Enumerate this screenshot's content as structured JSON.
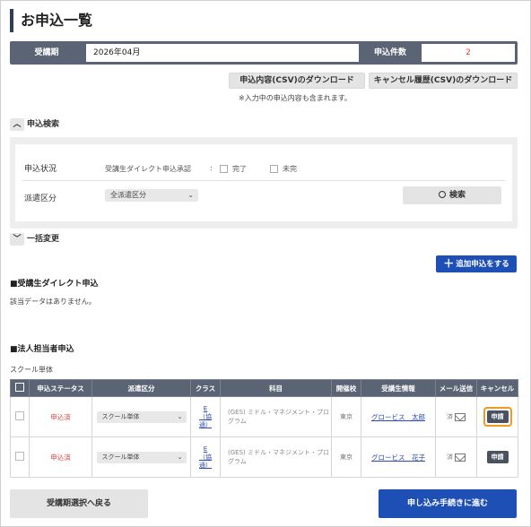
{
  "page": {
    "title": "お申込一覧"
  },
  "period": {
    "period_label": "受講期",
    "period_value": "2026年04月",
    "count_label": "申込件数",
    "count_value": "2"
  },
  "downloads": {
    "csv_label": "申込内容(CSV)のダウンロード",
    "cancel_csv_label": "キャンセル履歴(CSV)のダウンロード",
    "note": "※入力中の申込内容も含まれます。"
  },
  "search": {
    "toggle_label": "申込検索",
    "status_label": "申込状況",
    "direct_label": "受講生ダイレクト申込承認",
    "colon": ":",
    "opt_done": "完了",
    "opt_undone": "未完",
    "dispatch_label": "派遣区分",
    "dispatch_value": "全派遣区分",
    "search_button": "検索"
  },
  "bulk": {
    "toggle_label": "一括変更"
  },
  "add_button": "追加申込をする",
  "direct_section": {
    "heading": "■受講生ダイレクト申込",
    "empty": "該当データはありません。"
  },
  "corp_section": {
    "heading": "■法人担当者申込",
    "sub": "スクール単体"
  },
  "table": {
    "headers": [
      "申込ステータス",
      "派遣区分",
      "クラス",
      "科目",
      "開催校",
      "受講生情報",
      "メール送信",
      "キャンセル"
    ],
    "rows": [
      {
        "status": "申込済",
        "dispatch": "スクール単体",
        "class_line1": "E",
        "class_line2": "（協",
        "class_line3": "通）",
        "subject": "(GES) ミドル・マネジメント・プログラム",
        "school": "東京",
        "student": "グロービス　太郎",
        "mail": "済",
        "cancel": "申請"
      },
      {
        "status": "申込済",
        "dispatch": "スクール単体",
        "class_line1": "E",
        "class_line2": "（協",
        "class_line3": "通）",
        "subject": "(GES) ミドル・マネジメント・プログラム",
        "school": "東京",
        "student": "グロービス　花子",
        "mail": "済",
        "cancel": "申請"
      }
    ]
  },
  "footer": {
    "back_button": "受講期選択へ戻る",
    "proceed_button": "申し込み手続きに進む"
  },
  "colors": {
    "accent_blue": "#1e4fb5",
    "header_gray": "#5b6474",
    "status_red": "#e03a3a",
    "focus_orange": "#f29a1e"
  }
}
